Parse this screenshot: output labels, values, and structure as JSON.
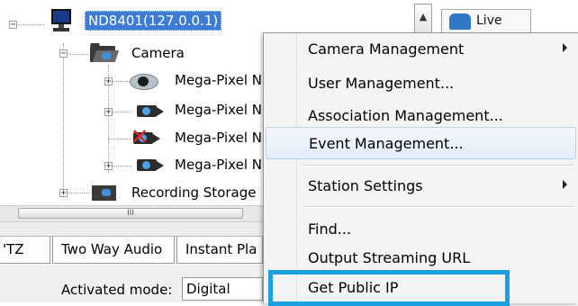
{
  "tree": {
    "root": {
      "label": "ND8401(127.0.0.1)",
      "icon": "monitor-icon"
    },
    "camera_folder": {
      "label": "Camera",
      "icon": "camera-folder-icon"
    },
    "cameras": [
      {
        "label": "Mega-Pixel N",
        "icon": "dome-camera-icon"
      },
      {
        "label": "Mega-Pixel N",
        "icon": "box-camera-icon"
      },
      {
        "label": "Mega-Pixel N",
        "icon": "camera-disconnected-icon"
      },
      {
        "label": "Mega-Pixel N",
        "icon": "box-camera-icon"
      }
    ],
    "recording_storage": {
      "label": "Recording Storage",
      "icon": "recording-storage-icon"
    }
  },
  "scrollbar": {
    "grip": "III"
  },
  "tabs": [
    {
      "label": "'TZ"
    },
    {
      "label": "Two Way Audio"
    },
    {
      "label": "Instant Pla"
    }
  ],
  "activated_mode": {
    "label": "Activated mode:",
    "value": "Digital"
  },
  "up_button": {
    "label": "▲"
  },
  "live_view": {
    "label": "Live View"
  },
  "context_menu": {
    "items": [
      {
        "label": "Camera Management",
        "submenu": true
      },
      {
        "label": "User Management..."
      },
      {
        "label": "Association Management..."
      },
      {
        "label": "Event Management...",
        "hover": true
      },
      {
        "label": "Station Settings",
        "submenu": true
      },
      {
        "label": "Find..."
      },
      {
        "label": "Output Streaming URL"
      },
      {
        "label": "Get Public IP",
        "highlighted": true
      }
    ],
    "highlight_color": "#1a9fe2"
  }
}
